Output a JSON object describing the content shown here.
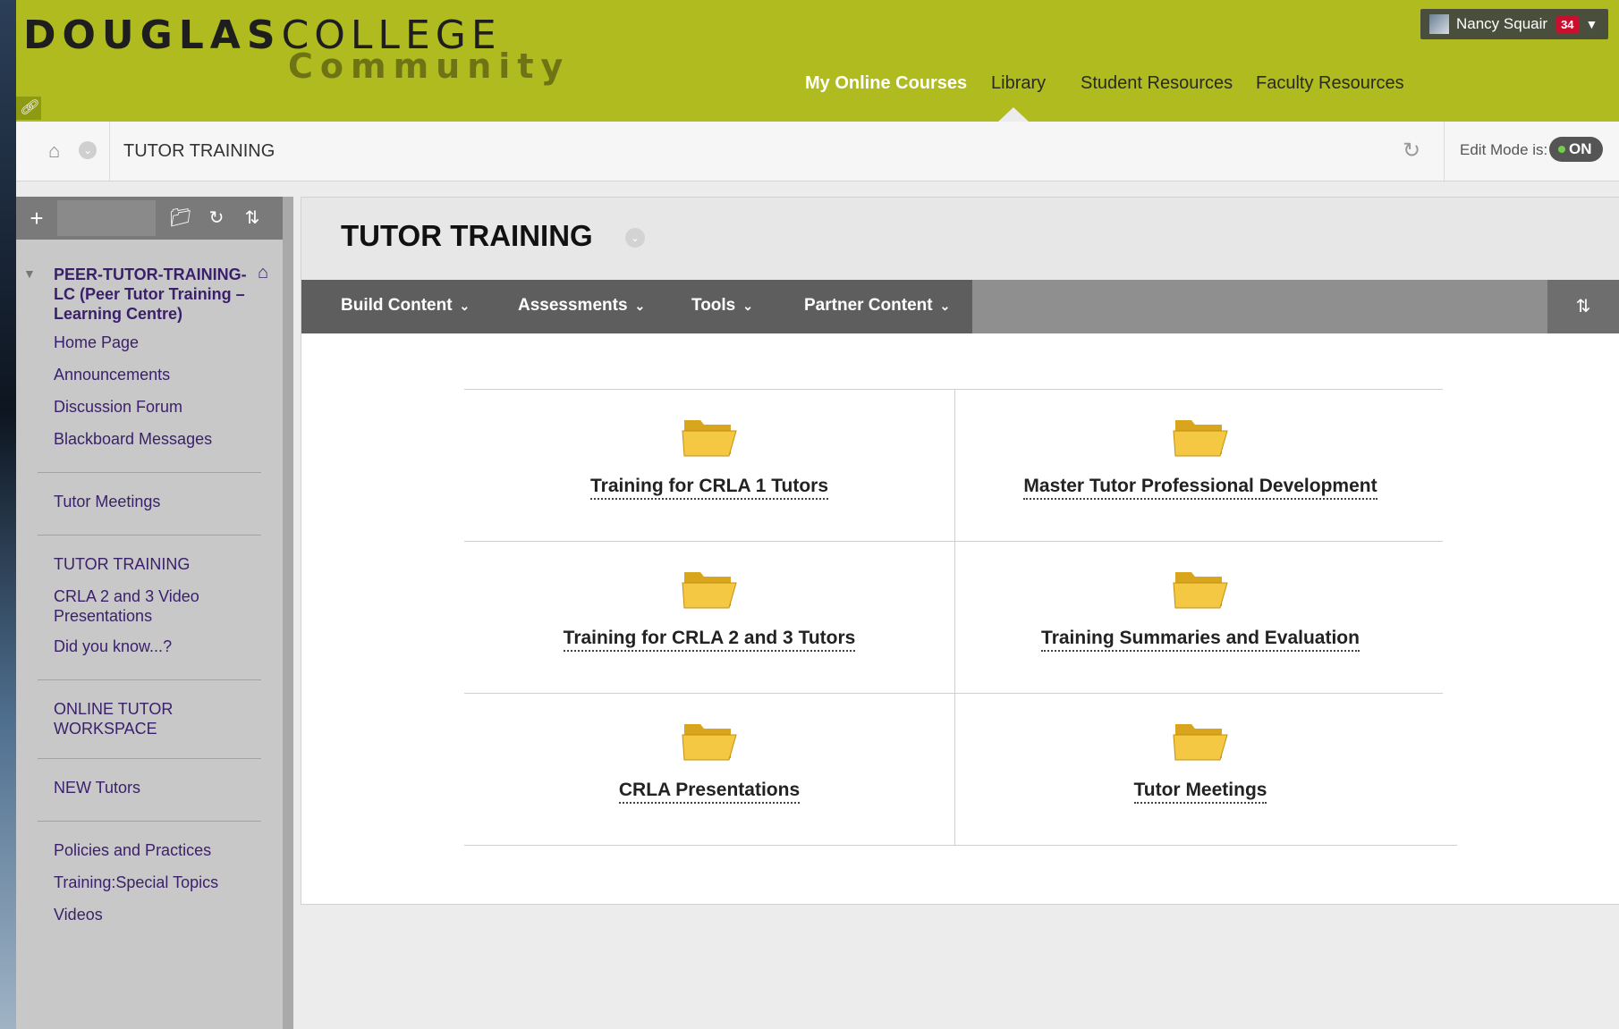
{
  "header": {
    "logo_bold": "DOUGLAS",
    "logo_light": "COLLEGE",
    "logo_sub": "Community",
    "user": {
      "name": "Nancy Squair",
      "badge": "34"
    },
    "tabs": [
      {
        "label": "My Online Courses",
        "active": true
      },
      {
        "label": "Library"
      },
      {
        "label": "Student Resources"
      },
      {
        "label": "Faculty Resources"
      }
    ]
  },
  "breadcrumb": {
    "title": "TUTOR TRAINING",
    "edit_mode_label": "Edit Mode is:",
    "edit_mode_value": "ON"
  },
  "sidebar": {
    "course_title": "PEER-TUTOR-TRAINING-LC (Peer Tutor Training – Learning Centre)",
    "groups": [
      [
        "Home Page",
        "Announcements",
        "Discussion Forum",
        "Blackboard Messages"
      ],
      [
        "Tutor Meetings"
      ],
      [
        "TUTOR TRAINING",
        "CRLA 2 and 3 Video Presentations",
        "Did you know...?"
      ],
      [
        "ONLINE TUTOR WORKSPACE"
      ],
      [
        "NEW Tutors"
      ],
      [
        "Policies and Practices",
        "Training:Special Topics",
        "Videos"
      ]
    ]
  },
  "content": {
    "title": "TUTOR TRAINING",
    "actions": [
      "Build Content",
      "Assessments",
      "Tools",
      "Partner Content"
    ],
    "folders": [
      "Training for CRLA 1 Tutors",
      "Master Tutor Professional Development",
      "Training for CRLA 2 and 3 Tutors",
      "Training Summaries and Evaluation",
      "CRLA Presentations",
      "Tutor Meetings"
    ]
  },
  "colors": {
    "header_bg": "#afbb1f",
    "nav_text": "#3a1f6a",
    "folder": "#f2c12e"
  }
}
